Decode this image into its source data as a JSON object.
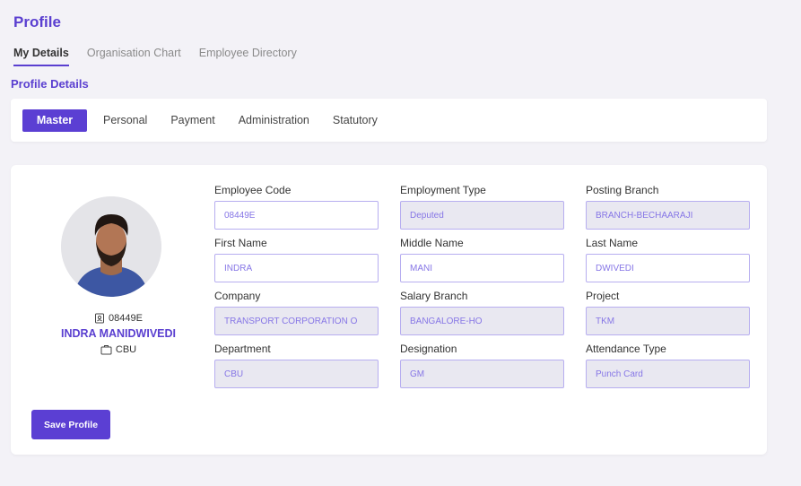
{
  "header": {
    "title": "Profile"
  },
  "top_tabs": [
    {
      "label": "My Details",
      "active": true
    },
    {
      "label": "Organisation Chart",
      "active": false
    },
    {
      "label": "Employee Directory",
      "active": false
    }
  ],
  "section_title": "Profile Details",
  "sub_tabs": [
    {
      "label": "Master",
      "active": true
    },
    {
      "label": "Personal",
      "active": false
    },
    {
      "label": "Payment",
      "active": false
    },
    {
      "label": "Administration",
      "active": false
    },
    {
      "label": "Statutory",
      "active": false
    }
  ],
  "profile": {
    "employee_code": "08449E",
    "name": "INDRA MANIDWIVEDI",
    "department": "CBU"
  },
  "fields": [
    {
      "label": "Employee Code",
      "value": "08449E",
      "editable": true
    },
    {
      "label": "Employment Type",
      "value": "Deputed",
      "editable": false
    },
    {
      "label": "Posting Branch",
      "value": "BRANCH-BECHAARAJI",
      "editable": false
    },
    {
      "label": "First Name",
      "value": "INDRA",
      "editable": true
    },
    {
      "label": "Middle Name",
      "value": "MANI",
      "editable": true
    },
    {
      "label": "Last Name",
      "value": "DWIVEDI",
      "editable": true
    },
    {
      "label": "Company",
      "value": "TRANSPORT CORPORATION O",
      "editable": false
    },
    {
      "label": "Salary Branch",
      "value": "BANGALORE-HO",
      "editable": false
    },
    {
      "label": "Project",
      "value": "TKM",
      "editable": false
    },
    {
      "label": "Department",
      "value": "CBU",
      "editable": false
    },
    {
      "label": "Designation",
      "value": "GM",
      "editable": false
    },
    {
      "label": "Attendance Type",
      "value": "Punch Card",
      "editable": false
    }
  ],
  "save_label": "Save Profile",
  "colors": {
    "accent": "#5b3fd3",
    "input_border": "#b7aef0",
    "disabled_bg": "#e9e8f1"
  }
}
